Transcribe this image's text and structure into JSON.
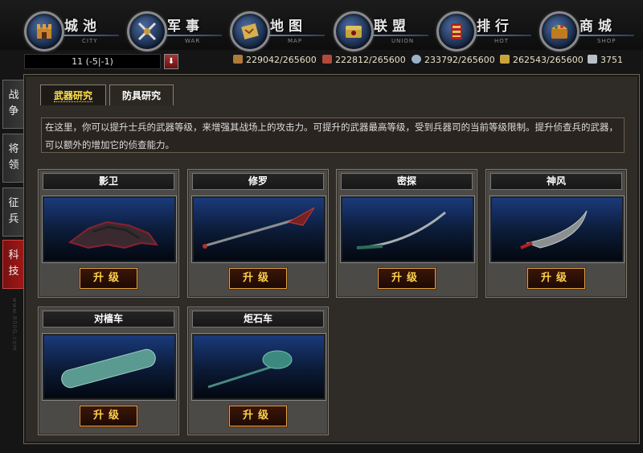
{
  "nav": [
    {
      "title": "城池",
      "sub": "CITY",
      "icon": "castle-icon"
    },
    {
      "title": "军事",
      "sub": "WAR",
      "icon": "crossed-swords-icon"
    },
    {
      "title": "地图",
      "sub": "MAP",
      "icon": "map-scroll-icon"
    },
    {
      "title": "联盟",
      "sub": "UNION",
      "icon": "alliance-chest-icon"
    },
    {
      "title": "排行",
      "sub": "HOT",
      "icon": "ranking-banner-icon"
    },
    {
      "title": "商城",
      "sub": "SHOP",
      "icon": "treasure-box-icon"
    }
  ],
  "location": "11  (-5|-1)",
  "download_glyph": "⬇",
  "resources": [
    {
      "name": "wood",
      "value": "229042/265600",
      "color": "#b07a3a"
    },
    {
      "name": "brick",
      "value": "222812/265600",
      "color": "#b04a3a"
    },
    {
      "name": "iron",
      "value": "233792/265600",
      "color": "#9ab2c8"
    },
    {
      "name": "grain",
      "value": "262543/265600",
      "color": "#c9a43a"
    },
    {
      "name": "silver",
      "value": "3751",
      "color": "#b8c0c8"
    }
  ],
  "side_tabs": [
    "战争",
    "将领",
    "征兵",
    "科技"
  ],
  "side_url": "www.800G.com",
  "subtabs": [
    "武器研究",
    "防具研究"
  ],
  "description": "在这里，你可以提升士兵的武器等级，来增强其战场上的攻击力。可提升的武器最高等级，受到兵器司的当前等级限制。提升侦查兵的武器，可以额外的增加它的侦查能力。",
  "weapons": [
    {
      "name": "影卫",
      "button": "升级"
    },
    {
      "name": "修罗",
      "button": "升级"
    },
    {
      "name": "密探",
      "button": "升级"
    },
    {
      "name": "神风",
      "button": "升级"
    },
    {
      "name": "对樯车",
      "button": "升级"
    },
    {
      "name": "炬石车",
      "button": "升级"
    }
  ]
}
